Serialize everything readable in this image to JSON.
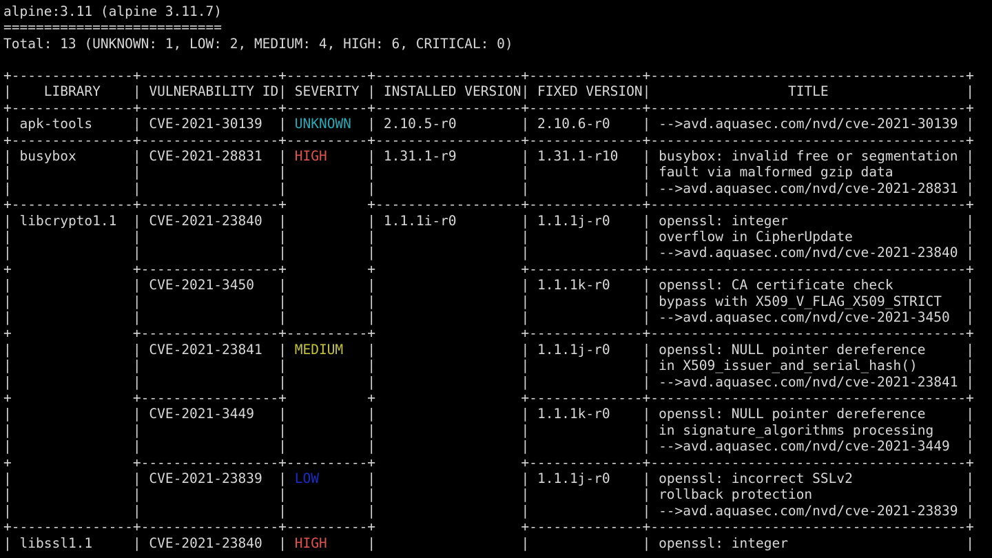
{
  "terminal": {
    "target": "alpine:3.11 (alpine 3.11.7)",
    "underline": "===========================",
    "summary": "Total: 13 (UNKNOWN: 1, LOW: 2, MEDIUM: 4, HIGH: 6, CRITICAL: 0)"
  },
  "table": {
    "headers": [
      "LIBRARY",
      "VULNERABILITY ID",
      "SEVERITY",
      "INSTALLED VERSION",
      "FIXED VERSION",
      "TITLE"
    ],
    "rows": [
      {
        "library": "apk-tools",
        "vulnerability_id": "CVE-2021-30139",
        "severity": "UNKNOWN",
        "installed_version": "2.10.5-r0",
        "fixed_version": "2.10.6-r0",
        "title": [
          "-->avd.aquasec.com/nvd/cve-2021-30139"
        ]
      },
      {
        "library": "busybox",
        "vulnerability_id": "CVE-2021-28831",
        "severity": "HIGH",
        "installed_version": "1.31.1-r9",
        "fixed_version": "1.31.1-r10",
        "title": [
          "busybox: invalid free or segmentation",
          "fault via malformed gzip data",
          "-->avd.aquasec.com/nvd/cve-2021-28831"
        ]
      },
      {
        "library": "libcrypto1.1",
        "vulnerability_id": "CVE-2021-23840",
        "severity": "",
        "installed_version": "1.1.1i-r0",
        "fixed_version": "1.1.1j-r0",
        "title": [
          "openssl: integer",
          "overflow in CipherUpdate",
          "-->avd.aquasec.com/nvd/cve-2021-23840"
        ]
      },
      {
        "library": "",
        "vulnerability_id": "CVE-2021-3450",
        "severity": "",
        "installed_version": "",
        "fixed_version": "1.1.1k-r0",
        "title": [
          "openssl: CA certificate check",
          "bypass with X509_V_FLAG_X509_STRICT",
          "-->avd.aquasec.com/nvd/cve-2021-3450"
        ]
      },
      {
        "library": "",
        "vulnerability_id": "CVE-2021-23841",
        "severity": "MEDIUM",
        "installed_version": "",
        "fixed_version": "1.1.1j-r0",
        "title": [
          "openssl: NULL pointer dereference",
          "in X509_issuer_and_serial_hash()",
          "-->avd.aquasec.com/nvd/cve-2021-23841"
        ]
      },
      {
        "library": "",
        "vulnerability_id": "CVE-2021-3449",
        "severity": "",
        "installed_version": "",
        "fixed_version": "1.1.1k-r0",
        "title": [
          "openssl: NULL pointer dereference",
          "in signature_algorithms processing",
          "-->avd.aquasec.com/nvd/cve-2021-3449"
        ]
      },
      {
        "library": "",
        "vulnerability_id": "CVE-2021-23839",
        "severity": "LOW",
        "installed_version": "",
        "fixed_version": "1.1.1j-r0",
        "title": [
          "openssl: incorrect SSLv2",
          "rollback protection",
          "-->avd.aquasec.com/nvd/cve-2021-23839"
        ]
      },
      {
        "library": "libssl1.1",
        "vulnerability_id": "CVE-2021-23840",
        "severity": "HIGH",
        "installed_version": "",
        "fixed_version": "",
        "title": [
          "openssl: integer"
        ]
      }
    ]
  },
  "colors": {
    "background": "#000000",
    "text": "#d8d8d8",
    "UNKNOWN": "#2aa9b5",
    "HIGH": "#e0534e",
    "MEDIUM": "#c4c43a",
    "LOW": "#1c2bc8"
  }
}
